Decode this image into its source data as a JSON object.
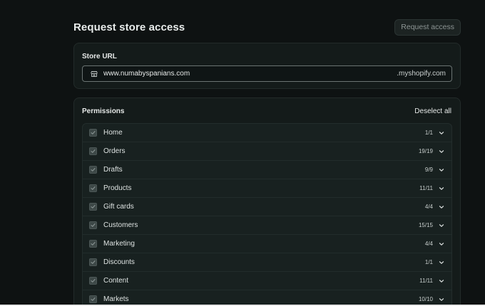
{
  "header": {
    "title": "Request store access",
    "request_button": "Request access"
  },
  "store_url": {
    "label": "Store URL",
    "value": "www.numabyspanians.com",
    "suffix": ".myshopify.com",
    "icon": "store-icon"
  },
  "permissions": {
    "title": "Permissions",
    "deselect_label": "Deselect all",
    "items": [
      {
        "label": "Home",
        "count": "1/1",
        "checked": true
      },
      {
        "label": "Orders",
        "count": "19/19",
        "checked": true
      },
      {
        "label": "Drafts",
        "count": "9/9",
        "checked": true
      },
      {
        "label": "Products",
        "count": "11/11",
        "checked": true
      },
      {
        "label": "Gift cards",
        "count": "4/4",
        "checked": true
      },
      {
        "label": "Customers",
        "count": "15/15",
        "checked": true
      },
      {
        "label": "Marketing",
        "count": "4/4",
        "checked": true
      },
      {
        "label": "Discounts",
        "count": "1/1",
        "checked": true
      },
      {
        "label": "Content",
        "count": "11/11",
        "checked": true
      },
      {
        "label": "Markets",
        "count": "10/10",
        "checked": true
      }
    ]
  },
  "colors": {
    "background": "#0e1212",
    "card": "#141b1a",
    "text": "#e6e9e8",
    "checkbox": "#3d4847"
  }
}
